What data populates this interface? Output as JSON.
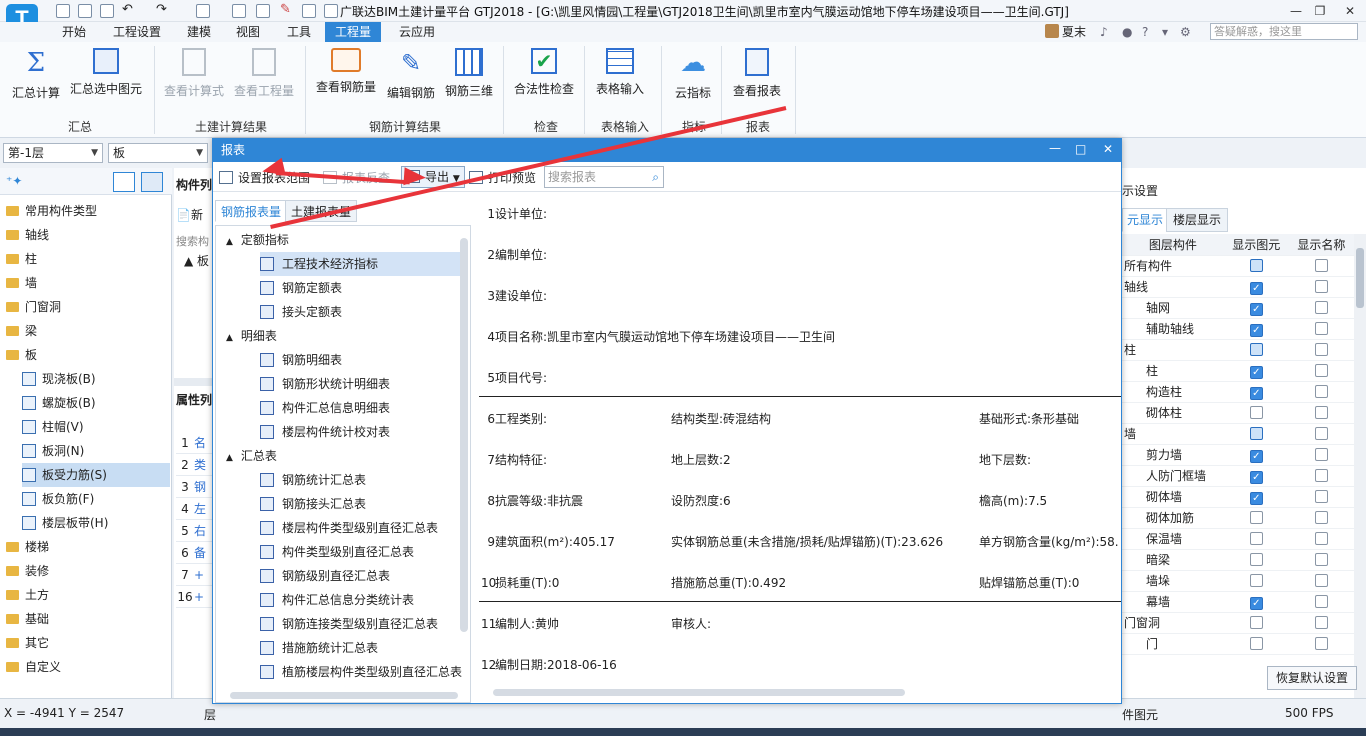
{
  "app": {
    "title": "广联达BIM土建计量平台 GTJ2018 - [G:\\凯里风情园\\工程量\\GTJ2018卫生间\\凯里市室内气膜运动馆地下停车场建设项目——卫生间.GTJ]",
    "logo_letter": "T",
    "user": "夏末",
    "help_search_placeholder": "答疑解惑，搜这里"
  },
  "menu": [
    "开始",
    "工程设置",
    "建模",
    "视图",
    "工具",
    "工程量",
    "云应用"
  ],
  "menu_active": "工程量",
  "ribbon": {
    "buttons": [
      {
        "label": "汇总计算",
        "icon": "sigma-icon",
        "enabled": true
      },
      {
        "label": "汇总选中图元",
        "icon": "calc-selected-icon",
        "enabled": true
      },
      {
        "label": "查看计算式",
        "icon": "view-formula-icon",
        "enabled": false
      },
      {
        "label": "查看工程量",
        "icon": "view-quantity-icon",
        "enabled": false
      },
      {
        "label": "查看钢筋量",
        "icon": "rebar-quantity-icon",
        "enabled": true
      },
      {
        "label": "编辑钢筋",
        "icon": "edit-rebar-icon",
        "enabled": true
      },
      {
        "label": "钢筋三维",
        "icon": "rebar-3d-icon",
        "enabled": true
      },
      {
        "label": "合法性检查",
        "icon": "check-icon",
        "enabled": true
      },
      {
        "label": "表格输入",
        "icon": "table-input-icon",
        "enabled": true
      },
      {
        "label": "云指标",
        "icon": "cloud-icon",
        "enabled": true
      },
      {
        "label": "查看报表",
        "icon": "view-report-icon",
        "enabled": true
      }
    ],
    "groups": [
      "汇总",
      "土建计算结果",
      "钢筋计算结果",
      "检查",
      "表格输入",
      "指标",
      "报表"
    ]
  },
  "floor_combo": "第-1层",
  "type_combo": "板",
  "left_tree": {
    "categories": [
      "常用构件类型",
      "轴线",
      "柱",
      "墙",
      "门窗洞",
      "梁",
      "板"
    ],
    "board_children": [
      "现浇板(B)",
      "螺旋板(B)",
      "柱帽(V)",
      "板洞(N)",
      "板受力筋(S)",
      "板负筋(F)",
      "楼层板带(H)"
    ],
    "selected_child": "板受力筋(S)",
    "more_categories": [
      "楼梯",
      "装修",
      "土方",
      "基础",
      "其它",
      "自定义"
    ]
  },
  "mid_panel": {
    "header": "构件列",
    "new_btn": "新",
    "search": "搜索构",
    "tree_node": "板",
    "props_header": "属性列",
    "rows": [
      "1",
      "2",
      "3",
      "4",
      "5",
      "6",
      "7",
      "16"
    ],
    "row_labels": [
      "名",
      "类",
      "钢",
      "左",
      "右",
      "备",
      "+",
      "+"
    ]
  },
  "dialog": {
    "title": "报表",
    "toolbar": {
      "set_range": "设置报表范围",
      "report_reverse": "报表反查",
      "export": "导出",
      "print_preview": "打印预览",
      "search_placeholder": "搜索报表"
    },
    "tabs": [
      "钢筋报表量",
      "土建报表量"
    ],
    "tree": [
      {
        "group": "定额指标",
        "items": [
          "工程技术经济指标",
          "钢筋定额表",
          "接头定额表"
        ]
      },
      {
        "group": "明细表",
        "items": [
          "钢筋明细表",
          "钢筋形状统计明细表",
          "构件汇总信息明细表",
          "楼层构件统计校对表"
        ]
      },
      {
        "group": "汇总表",
        "items": [
          "钢筋统计汇总表",
          "钢筋接头汇总表",
          "楼层构件类型级别直径汇总表",
          "构件类型级别直径汇总表",
          "钢筋级别直径汇总表",
          "构件汇总信息分类统计表",
          "钢筋连接类型级别直径汇总表",
          "措施筋统计汇总表",
          "植筋楼层构件类型级别直径汇总表"
        ]
      }
    ],
    "selected_item": "工程技术经济指标",
    "report_rows": [
      {
        "n": "1",
        "c1": "设计单位:",
        "c2": "",
        "c3": ""
      },
      {
        "n": "2",
        "c1": "编制单位:",
        "c2": "",
        "c3": ""
      },
      {
        "n": "3",
        "c1": "建设单位:",
        "c2": "",
        "c3": ""
      },
      {
        "n": "4",
        "c1": "项目名称:凯里市室内气膜运动馆地下停车场建设项目——卫生间",
        "c2": "",
        "c3": ""
      },
      {
        "n": "5",
        "c1": "项目代号:",
        "c2": "",
        "c3": ""
      },
      {
        "n": "6",
        "c1": "工程类别:",
        "c2": "结构类型:砖混结构",
        "c3": "基础形式:条形基础"
      },
      {
        "n": "7",
        "c1": "结构特征:",
        "c2": "地上层数:2",
        "c3": "地下层数:"
      },
      {
        "n": "8",
        "c1": "抗震等级:非抗震",
        "c2": "设防烈度:6",
        "c3": "檐高(m):7.5"
      },
      {
        "n": "9",
        "c1": "建筑面积(m²):405.17",
        "c2": "实体钢筋总重(未含措施/损耗/贴焊锚筋)(T):23.626",
        "c3": "单方钢筋含量(kg/m²):58."
      },
      {
        "n": "10",
        "c1": "损耗重(T):0",
        "c2": "措施筋总重(T):0.492",
        "c3": "贴焊锚筋总重(T):0"
      },
      {
        "n": "11",
        "c1": "编制人:黄帅",
        "c2": "审核人:",
        "c3": ""
      },
      {
        "n": "12",
        "c1": "编制日期:2018-06-16",
        "c2": "",
        "c3": ""
      }
    ]
  },
  "right_panel": {
    "title": "示设置",
    "tabs": [
      "元显示",
      "楼层显示"
    ],
    "headers": [
      "图层构件",
      "显示图元",
      "显示名称"
    ],
    "rows": [
      {
        "name": "所有构件",
        "indent": 0,
        "show": "part",
        "label": "off"
      },
      {
        "name": "轴线",
        "indent": 0,
        "show": "on",
        "label": "off"
      },
      {
        "name": "轴网",
        "indent": 1,
        "show": "on",
        "label": "off"
      },
      {
        "name": "辅助轴线",
        "indent": 1,
        "show": "on",
        "label": "off"
      },
      {
        "name": "柱",
        "indent": 0,
        "show": "part",
        "label": "off"
      },
      {
        "name": "柱",
        "indent": 1,
        "show": "on",
        "label": "off"
      },
      {
        "name": "构造柱",
        "indent": 1,
        "show": "on",
        "label": "off"
      },
      {
        "name": "砌体柱",
        "indent": 1,
        "show": "off",
        "label": "off"
      },
      {
        "name": "墙",
        "indent": 0,
        "show": "part",
        "label": "off"
      },
      {
        "name": "剪力墙",
        "indent": 1,
        "show": "on",
        "label": "off"
      },
      {
        "name": "人防门框墙",
        "indent": 1,
        "show": "on",
        "label": "off"
      },
      {
        "name": "砌体墙",
        "indent": 1,
        "show": "on",
        "label": "off"
      },
      {
        "name": "砌体加筋",
        "indent": 1,
        "show": "off",
        "label": "off"
      },
      {
        "name": "保温墙",
        "indent": 1,
        "show": "off",
        "label": "off"
      },
      {
        "name": "暗梁",
        "indent": 1,
        "show": "off",
        "label": "off"
      },
      {
        "name": "墙垛",
        "indent": 1,
        "show": "off",
        "label": "off"
      },
      {
        "name": "幕墙",
        "indent": 1,
        "show": "on",
        "label": "off"
      },
      {
        "name": "门窗洞",
        "indent": 0,
        "show": "off",
        "label": "off"
      },
      {
        "name": "门",
        "indent": 1,
        "show": "off",
        "label": "off"
      }
    ],
    "restore_btn": "恢复默认设置"
  },
  "status": {
    "coords": "X = -4941 Y = 2547",
    "layer_text": "层",
    "select_text": "件图元",
    "fps": "500 FPS"
  },
  "colors": {
    "accent": "#2f86d6",
    "arrow": "#e8343a",
    "folder": "#e8b642"
  }
}
